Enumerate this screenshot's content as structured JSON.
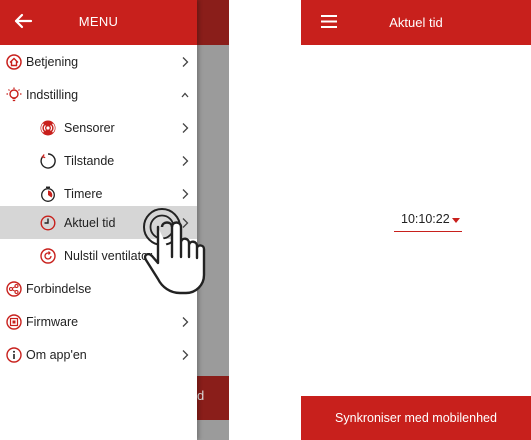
{
  "left_screen": {
    "drawer": {
      "title": "MENU",
      "items": [
        {
          "label": "Betjening",
          "icon": "home-icon",
          "chevron": "right"
        },
        {
          "label": "Indstilling",
          "icon": "settings-bulb-icon",
          "chevron": "up"
        },
        {
          "label": "Sensorer",
          "icon": "sensor-icon",
          "chevron": "right"
        },
        {
          "label": "Tilstande",
          "icon": "mode-circle-icon",
          "chevron": "right"
        },
        {
          "label": "Timere",
          "icon": "timer-icon",
          "chevron": "right"
        },
        {
          "label": "Aktuel tid",
          "icon": "clock-icon",
          "chevron": "right",
          "selected": true
        },
        {
          "label": "Nulstil ventilator",
          "icon": "reset-icon",
          "chevron": "none"
        },
        {
          "label": "Forbindelse",
          "icon": "share-icon",
          "chevron": "right"
        },
        {
          "label": "Firmware",
          "icon": "chip-icon",
          "chevron": "right"
        },
        {
          "label": "Om app'en",
          "icon": "info-icon",
          "chevron": "right"
        }
      ]
    },
    "background_footer_fragment": "d"
  },
  "right_screen": {
    "header_title": "Aktuel tid",
    "time_value": "10:10:22",
    "footer_button": "Synkroniser med mobilenhed"
  },
  "colors": {
    "brand_red": "#c8201c",
    "dark_red": "#8a1e1a",
    "selected_bg": "#d6d6d6",
    "overlay_grey": "#9b9b9b"
  }
}
